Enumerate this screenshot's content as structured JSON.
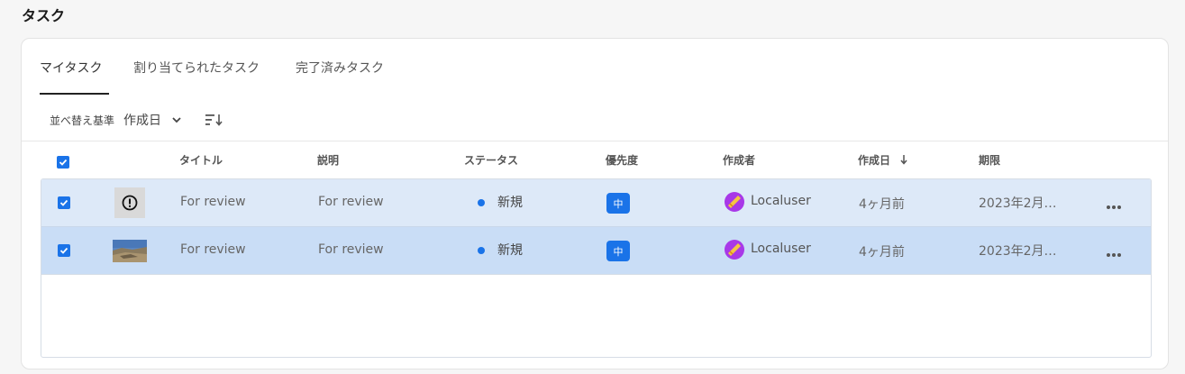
{
  "page": {
    "title": "タスク"
  },
  "tabs": [
    {
      "label": "マイタスク",
      "active": true
    },
    {
      "label": "割り当てられたタスク",
      "active": false
    },
    {
      "label": "完了済みタスク",
      "active": false
    }
  ],
  "sort": {
    "label": "並べ替え基準",
    "value": "作成日",
    "direction": "descending"
  },
  "table": {
    "columns": [
      "タイトル",
      "説明",
      "ステータス",
      "優先度",
      "作成者",
      "作成日",
      "期限"
    ],
    "sorted_column": "作成日",
    "rows": [
      {
        "selected": true,
        "thumbnail": "alert-icon",
        "title": "For review",
        "description": "For review",
        "status": "新規",
        "priority": "中",
        "creator": "Localuser",
        "created": "4ヶ月前",
        "due": "2023年2月…"
      },
      {
        "selected": true,
        "thumbnail": "landscape-image",
        "title": "For review",
        "description": "For review",
        "status": "新規",
        "priority": "中",
        "creator": "Localuser",
        "created": "4ヶ月前",
        "due": "2023年2月…"
      }
    ]
  },
  "colors": {
    "accent": "#1a73e8",
    "row_selected": "#dde9f8",
    "row_hover": "#c9ddf6",
    "avatar": "#a838e8"
  }
}
